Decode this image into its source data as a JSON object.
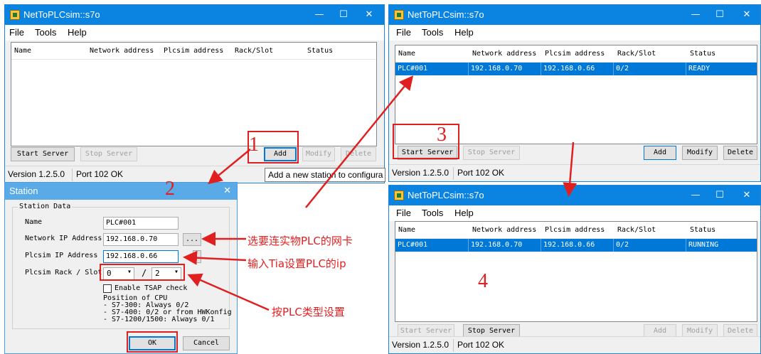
{
  "app": {
    "title": "NetToPLCsim::s7o",
    "menu": [
      "File",
      "Tools",
      "Help"
    ],
    "minimize_icon": "—",
    "maximize_icon": "☐",
    "close_icon": "✕"
  },
  "columns": [
    "Name",
    "Network address",
    "Plcsim address",
    "Rack/Slot",
    "Status"
  ],
  "buttons": {
    "start": "Start Server",
    "stop": "Stop Server",
    "add": "Add",
    "modify": "Modify",
    "delete": "Delete"
  },
  "status": {
    "version": "Version 1.2.5.0",
    "port": "Port 102 OK"
  },
  "windows": {
    "w1": {
      "rows": []
    },
    "w3": {
      "row": {
        "name": "PLC#001",
        "net": "192.168.0.70",
        "plcsim": "192.168.0.66",
        "rack": "0/2",
        "status": "READY"
      }
    },
    "w4": {
      "row": {
        "name": "PLC#001",
        "net": "192.168.0.70",
        "plcsim": "192.168.0.66",
        "rack": "0/2",
        "status": "RUNNING"
      }
    }
  },
  "tooltip": "Add a new station to configura",
  "station": {
    "title": "Station",
    "group": "Station Data",
    "name_label": "Name",
    "name_value": "PLC#001",
    "net_label": "Network IP Address",
    "net_value": "192.168.0.70",
    "browse": "...",
    "plcsim_label": "Plcsim IP Address",
    "plcsim_value": "192.168.0.66",
    "rack_label": "Plcsim Rack / Slot",
    "rack_value": "0",
    "slash": "/",
    "slot_value": "2",
    "tsap": "Enable TSAP check",
    "cpu_lines": [
      "Position of CPU",
      "- S7-300: Always 0/2",
      "- S7-400: 0/2 or from HWKonfig",
      "- S7-1200/1500: Always 0/1"
    ],
    "ok": "OK",
    "cancel": "Cancel"
  },
  "steps": [
    "1",
    "2",
    "3",
    "4"
  ],
  "annotations": {
    "a1": "选要连实物PLC的网卡",
    "a2": "输入Tia设置PLC的ip",
    "a3": "按PLC类型设置"
  },
  "colors": {
    "titlebar": "#0a84e0",
    "selection": "#0078d7",
    "annotation": "#e02020"
  }
}
